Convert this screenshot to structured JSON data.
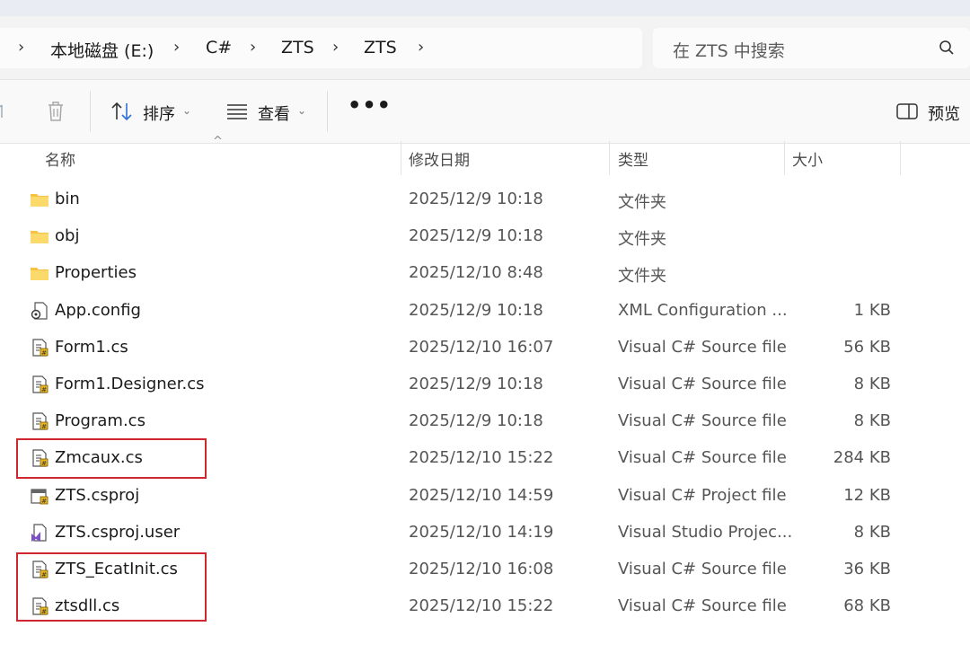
{
  "breadcrumb": [
    "本地磁盘 (E:)",
    "C#",
    "ZTS",
    "ZTS"
  ],
  "search": {
    "placeholder": "在 ZTS 中搜索"
  },
  "toolbar": {
    "sort_label": "排序",
    "view_label": "查看",
    "more_label": "•••",
    "preview_label": "预览"
  },
  "columns": {
    "name": "名称",
    "modified": "修改日期",
    "type": "类型",
    "size": "大小"
  },
  "files": [
    {
      "name": "bin",
      "modified": "2025/12/9 10:18",
      "type": "文件夹",
      "size": "",
      "icon": "folder-icon"
    },
    {
      "name": "obj",
      "modified": "2025/12/9 10:18",
      "type": "文件夹",
      "size": "",
      "icon": "folder-icon"
    },
    {
      "name": "Properties",
      "modified": "2025/12/10 8:48",
      "type": "文件夹",
      "size": "",
      "icon": "folder-icon"
    },
    {
      "name": "App.config",
      "modified": "2025/12/9 10:18",
      "type": "XML Configuration ...",
      "size": "1 KB",
      "icon": "config-file-icon"
    },
    {
      "name": "Form1.cs",
      "modified": "2025/12/10 16:07",
      "type": "Visual C# Source file",
      "size": "56 KB",
      "icon": "csharp-file-icon"
    },
    {
      "name": "Form1.Designer.cs",
      "modified": "2025/12/9 10:18",
      "type": "Visual C# Source file",
      "size": "8 KB",
      "icon": "csharp-file-icon"
    },
    {
      "name": "Program.cs",
      "modified": "2025/12/9 10:18",
      "type": "Visual C# Source file",
      "size": "8 KB",
      "icon": "csharp-file-icon"
    },
    {
      "name": "Zmcaux.cs",
      "modified": "2025/12/10 15:22",
      "type": "Visual C# Source file",
      "size": "284 KB",
      "icon": "csharp-file-icon"
    },
    {
      "name": "ZTS.csproj",
      "modified": "2025/12/10 14:59",
      "type": "Visual C# Project file",
      "size": "12 KB",
      "icon": "csproj-file-icon"
    },
    {
      "name": "ZTS.csproj.user",
      "modified": "2025/12/10 14:19",
      "type": "Visual Studio Projec...",
      "size": "8 KB",
      "icon": "vs-user-file-icon"
    },
    {
      "name": "ZTS_EcatInit.cs",
      "modified": "2025/12/10 16:08",
      "type": "Visual C# Source file",
      "size": "36 KB",
      "icon": "csharp-file-icon"
    },
    {
      "name": "ztsdll.cs",
      "modified": "2025/12/10 15:22",
      "type": "Visual C# Source file",
      "size": "68 KB",
      "icon": "csharp-file-icon"
    }
  ],
  "colors": {
    "highlight_border": "#d0262f",
    "folder": "#f5c243"
  }
}
